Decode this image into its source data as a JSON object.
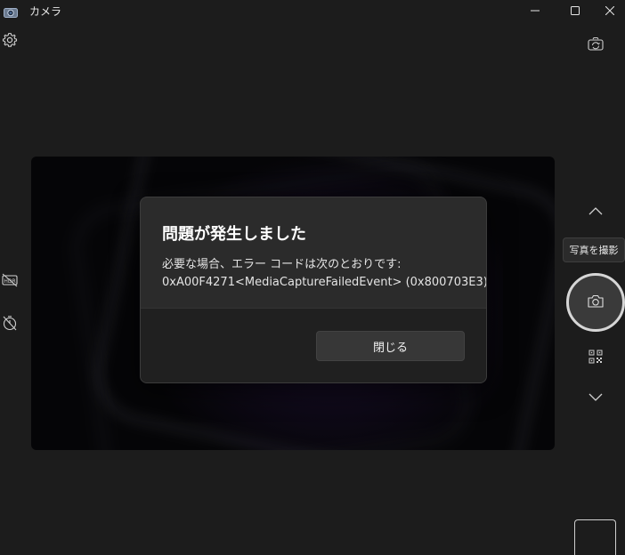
{
  "window": {
    "title": "カメラ",
    "icons": {
      "app": "camera-app-icon",
      "minimize": "minimize-icon",
      "maximize": "maximize-icon",
      "close": "close-icon"
    }
  },
  "left_rail": {
    "icons": [
      "settings-gear-icon",
      "hdr-off-icon",
      "timer-off-icon"
    ]
  },
  "right_rail": {
    "icons": [
      "switch-camera-icon",
      "chevron-up-icon",
      "camera-icon",
      "qr-code-icon",
      "chevron-down-icon"
    ],
    "mode_tooltip": "写真を撮影"
  },
  "dialog": {
    "title": "問題が発生しました",
    "message_line1": "必要な場合、エラー コードは次のとおりです:",
    "message_line2": "0xA00F4271<MediaCaptureFailedEvent> (0x800703E3)",
    "close_button_label": "閉じる"
  },
  "colors": {
    "background": "#1c1c1c",
    "dialog_bg": "#2b2b2b",
    "dialog_footer_bg": "#202020",
    "text": "#ffffff"
  }
}
